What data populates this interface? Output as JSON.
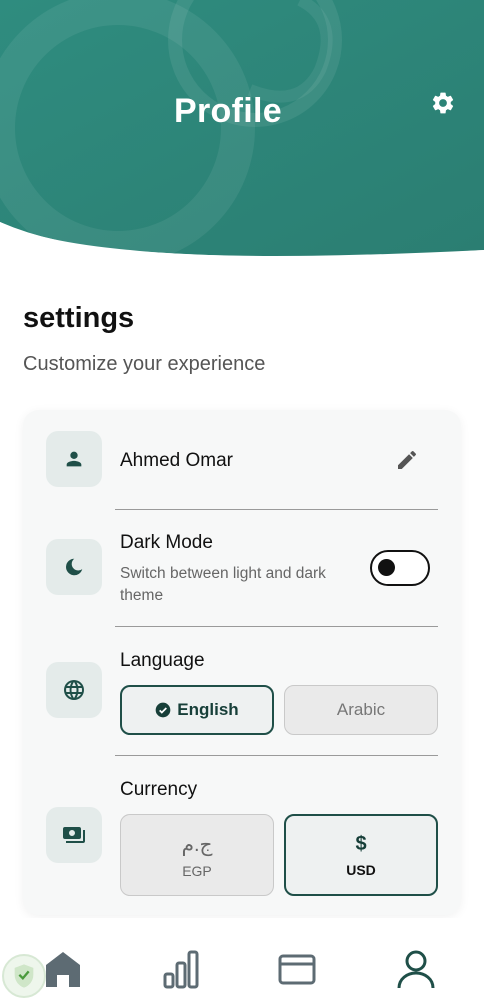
{
  "header": {
    "title": "Profile"
  },
  "settings": {
    "heading": "settings",
    "subtitle": "Customize your experience"
  },
  "profile": {
    "name": "Ahmed Omar"
  },
  "dark_mode": {
    "title": "Dark Mode",
    "description": "Switch between light and dark theme",
    "enabled": false
  },
  "language": {
    "title": "Language",
    "options": [
      "English",
      "Arabic"
    ],
    "selected": "English"
  },
  "currency": {
    "title": "Currency",
    "options": [
      {
        "symbol": "ج.م",
        "code": "EGP"
      },
      {
        "symbol": "$",
        "code": "USD"
      }
    ],
    "selected": "USD"
  },
  "nav": {
    "items": [
      "home-icon",
      "stats-icon",
      "wallet-icon",
      "profile-icon"
    ],
    "active": "profile-icon"
  },
  "colors": {
    "brand": "#2e8a7d",
    "accent_dark": "#1f4f48"
  }
}
